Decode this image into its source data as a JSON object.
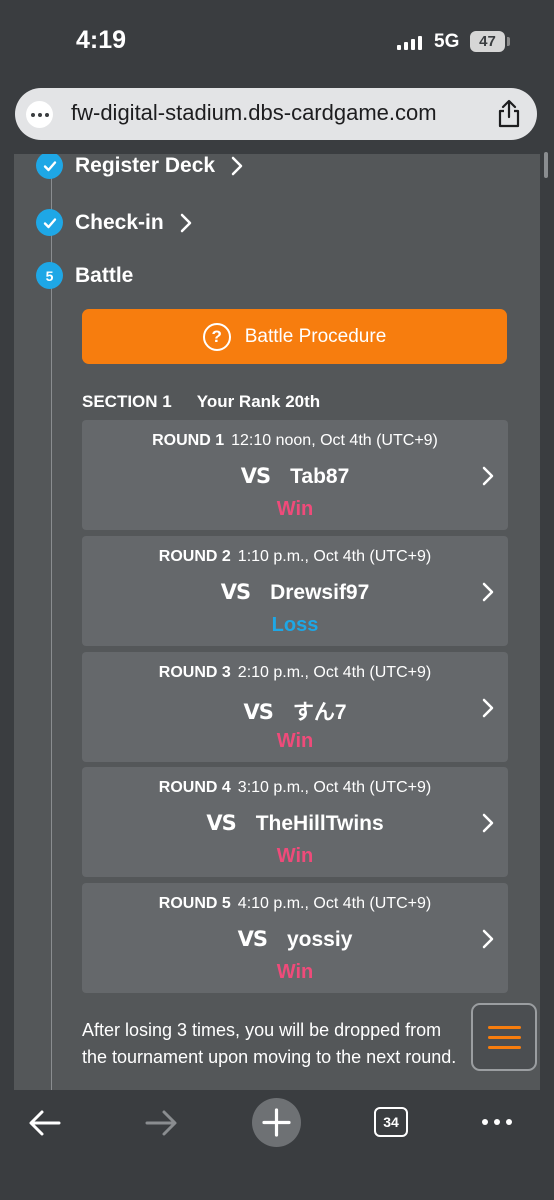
{
  "status": {
    "time": "4:19",
    "network": "5G",
    "battery": "47"
  },
  "browser": {
    "url": "fw-digital-stadium.dbs-cardgame.com",
    "tab_count": "34"
  },
  "steps": [
    {
      "label": "Register Deck",
      "state": "done",
      "icon": "check-icon"
    },
    {
      "label": "Check-in",
      "state": "done",
      "icon": "check-icon"
    },
    {
      "label": "Battle",
      "state": "current",
      "number": "5"
    }
  ],
  "battle_procedure": {
    "icon_glyph": "?",
    "label": "Battle Procedure"
  },
  "section": {
    "name": "SECTION 1",
    "rank": "Your Rank 20th"
  },
  "rounds": [
    {
      "label": "ROUND 1",
      "time": "12:10 noon, Oct 4th (UTC+9)",
      "vs": "VS",
      "opponent": "Tab87",
      "result": "Win"
    },
    {
      "label": "ROUND 2",
      "time": "1:10 p.m., Oct 4th (UTC+9)",
      "vs": "VS",
      "opponent": "Drewsif97",
      "result": "Loss"
    },
    {
      "label": "ROUND 3",
      "time": "2:10 p.m., Oct 4th (UTC+9)",
      "vs": "VS",
      "opponent": "すん7",
      "result": "Win"
    },
    {
      "label": "ROUND 4",
      "time": "3:10 p.m., Oct 4th (UTC+9)",
      "vs": "VS",
      "opponent": "TheHillTwins",
      "result": "Win"
    },
    {
      "label": "ROUND 5",
      "time": "4:10 p.m., Oct 4th (UTC+9)",
      "vs": "VS",
      "opponent": "yossiy",
      "result": "Win"
    }
  ],
  "note": {
    "line1": "After losing 3 times, you will be dropped from",
    "line2": "the tournament upon moving to the next round."
  },
  "colors": {
    "accent": "#f77d0e",
    "win": "#ef4b7a",
    "loss": "#1ea7e6",
    "step": "#1ea7e6"
  }
}
